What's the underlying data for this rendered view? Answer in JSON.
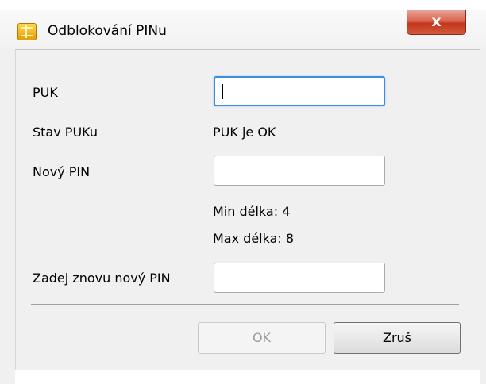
{
  "window": {
    "title": "Odblokování PINu",
    "close_label": "x"
  },
  "form": {
    "puk_label": "PUK",
    "puk_value": "",
    "puk_status_label": "Stav PUKu",
    "puk_status_value": "PUK je OK",
    "new_pin_label": "Nový PIN",
    "new_pin_value": "",
    "min_length_text": "Min délka: 4",
    "max_length_text": "Max délka: 8",
    "repeat_pin_label": "Zadej znovu nový PIN",
    "repeat_pin_value": ""
  },
  "buttons": {
    "ok_label": "OK",
    "ok_enabled": false,
    "cancel_label": "Zruš"
  },
  "icons": {
    "app_icon": "smartcard-chip-icon",
    "close_icon": "close-icon"
  },
  "colors": {
    "close_button": "#c8442a",
    "focus_border": "#3d8ee0",
    "disabled_text": "#9a9a9a"
  }
}
